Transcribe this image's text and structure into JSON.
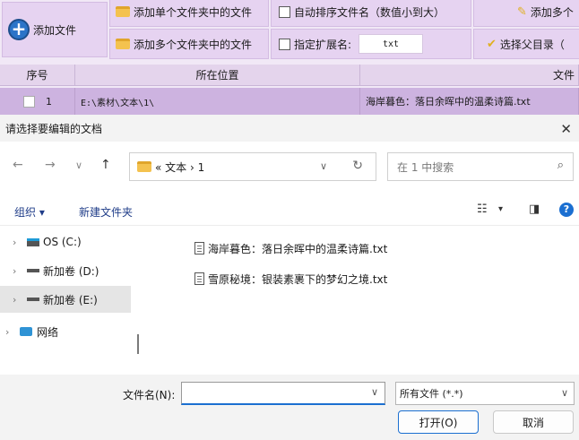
{
  "app": {
    "toolbar": {
      "add_file": "添加文件",
      "add_single_folder": "添加单个文件夹中的文件",
      "add_multi_folder": "添加多个文件夹中的文件",
      "auto_sort": "自动排序文件名（数值小到大）",
      "specify_ext": "指定扩展名:",
      "ext_value": "txt",
      "add_multi_partial": "添加多个",
      "select_parent_partial": "选择父目录（"
    },
    "grid": {
      "headers": [
        "序号",
        "所在位置",
        "文件"
      ],
      "rows": [
        {
          "index": "1",
          "location": "E:\\素材\\文本\\1\\",
          "file": "海岸暮色：落日余晖中的温柔诗篇.txt"
        }
      ]
    }
  },
  "dialog": {
    "title": "请选择要编辑的文档",
    "breadcrumb": "« 文本 › 1",
    "search_placeholder": "在 1 中搜索",
    "organize": "组织 ▾",
    "new_folder": "新建文件夹",
    "nav_tree": [
      {
        "label": "OS (C:)",
        "type": "os-drive"
      },
      {
        "label": "新加卷 (D:)",
        "type": "drive"
      },
      {
        "label": "新加卷 (E:)",
        "type": "drive",
        "selected": true
      },
      {
        "label": "网络",
        "type": "network"
      }
    ],
    "files": [
      "海岸暮色：落日余晖中的温柔诗篇.txt",
      "雪原秘境：银装素裹下的梦幻之境.txt"
    ],
    "filename_label": "文件名(N):",
    "filename_value": "",
    "filetype_value": "所有文件 (*.*)",
    "open_button": "打开(O)",
    "cancel_button": "取消"
  }
}
